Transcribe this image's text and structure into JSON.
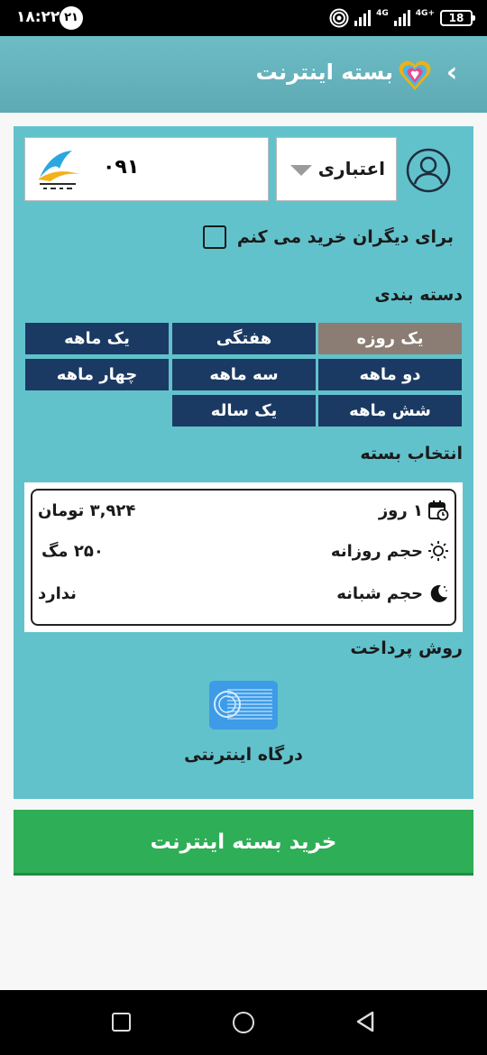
{
  "status_bar": {
    "time": "۱۸:۲۲",
    "notification_count": "۲۱",
    "network_label_1": "4G",
    "network_label_2": "4G+",
    "battery": "18"
  },
  "header": {
    "title": "بسته اینترنت",
    "back_icon": "chevron-left-icon",
    "color": "#62b4be"
  },
  "account": {
    "avatar_icon": "user-avatar-icon",
    "plan_type": "اعتباری",
    "phone_value": "۰۹۱",
    "operator_logo": "hamrah-aval-logo"
  },
  "gift": {
    "label": "برای دیگران خرید می کنم",
    "checked": false
  },
  "categories": {
    "label": "دسته بندی",
    "items": [
      {
        "label": "یک روزه",
        "active": true
      },
      {
        "label": "هفتگی",
        "active": false
      },
      {
        "label": "یک ماهه",
        "active": false
      },
      {
        "label": "دو ماهه",
        "active": false
      },
      {
        "label": "سه ماهه",
        "active": false
      },
      {
        "label": "چهار ماهه",
        "active": false
      },
      {
        "label": "شش ماهه",
        "active": false
      },
      {
        "label": "یک ساله",
        "active": false
      }
    ],
    "active_color": "#8b7d73",
    "inactive_color": "#1b3a63"
  },
  "package_select": {
    "label": "انتخاب بسته",
    "package": {
      "duration": "۱ روز",
      "price": "۳,۹۲۴ تومان",
      "daily_label": "حجم روزانه",
      "daily_value": "۲۵۰ مگ",
      "night_label": "حجم شبانه",
      "night_value": "ندارد"
    }
  },
  "payment": {
    "label": "روش پرداخت",
    "gateway_label": "درگاه اینترنتی",
    "gateway_icon": "card-payment-icon"
  },
  "buy_button": {
    "label": "خرید بسته اینترنت",
    "color": "#2eae56"
  },
  "nav_bar": {
    "recents_icon": "square-recents-icon",
    "home_icon": "circle-home-icon",
    "back_icon": "triangle-back-icon"
  }
}
